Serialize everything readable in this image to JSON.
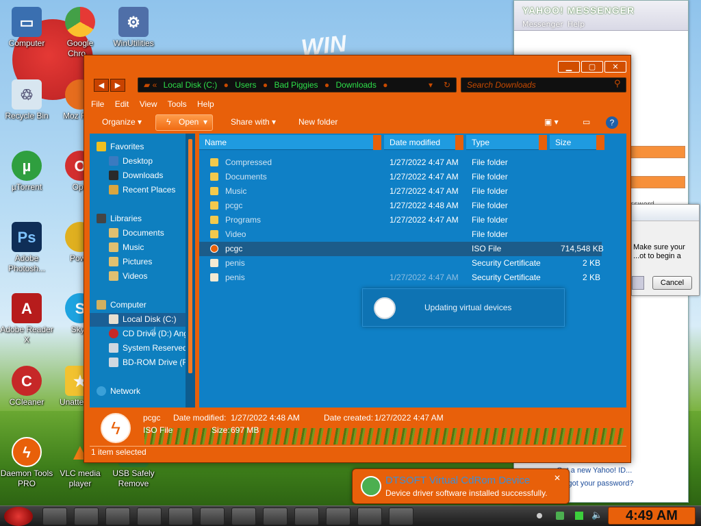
{
  "desktop": {
    "background_word": "WIN",
    "icons": [
      {
        "label": "Computer",
        "color": "#3a6fb0"
      },
      {
        "label": "Google Chro...",
        "color": "#e53935"
      },
      {
        "label": "WinUtilities",
        "color": "#4f6fa8"
      },
      {
        "label": "Recycle Bin",
        "color": "#d8e6f0"
      },
      {
        "label": "Moz Firef",
        "color": "#e66d1e"
      },
      {
        "label": "µTorrent",
        "color": "#2f9f3f"
      },
      {
        "label": "Ope",
        "color": "#d32f2f"
      },
      {
        "label": "Adobe Photosh...",
        "color": "#0f2e57"
      },
      {
        "label": "Powe",
        "color": "#e0b020"
      },
      {
        "label": "Adobe Reader X",
        "color": "#b71c1c"
      },
      {
        "label": "Skyp",
        "color": "#1ea3e0"
      },
      {
        "label": "CCleaner",
        "color": "#c62828"
      },
      {
        "label": "Unatte Soft",
        "color": "#f2c230"
      },
      {
        "label": "Daemon Tools PRO",
        "color": "#e8600a"
      },
      {
        "label": "VLC media player",
        "color": "#f07c14"
      },
      {
        "label": "USB Safely Remove",
        "color": "#2e7d32"
      }
    ]
  },
  "yahoo": {
    "title": "YAHOO! MESSENGER",
    "menu": [
      "Messenger",
      "Help"
    ],
    "link_new_id": "Get a new Yahoo! ID...",
    "link_forgot": "Forgot your password?",
    "partial_password": "ssword"
  },
  "dialog": {
    "text": "Make sure your ...ot to begin a",
    "cancel_label": "Cancel"
  },
  "explorer": {
    "window_controls": [
      "minimize",
      "maximize",
      "close"
    ],
    "address": [
      "Local Disk (C:)",
      "Users",
      "Bad Piggies",
      "Downloads"
    ],
    "search_placeholder": "Search Downloads",
    "menu": [
      "File",
      "Edit",
      "View",
      "Tools",
      "Help"
    ],
    "toolbar": {
      "organize": "Organize",
      "open": "Open",
      "share_with": "Share with",
      "new_folder": "New folder"
    },
    "sidebar": {
      "favorites": "Favorites",
      "fav_items": [
        "Desktop",
        "Downloads",
        "Recent Places"
      ],
      "libraries": "Libraries",
      "lib_items": [
        "Documents",
        "Music",
        "Pictures",
        "Videos"
      ],
      "computer": "Computer",
      "comp_items": [
        "Local Disk (C:)",
        "CD Drive (D:) Ang",
        "System Reserved",
        "BD-ROM Drive (F"
      ],
      "network": "Network"
    },
    "columns": {
      "name": "Name",
      "date": "Date modified",
      "type": "Type",
      "size": "Size"
    },
    "files": [
      {
        "name": "Compressed",
        "date": "1/27/2022 4:47 AM",
        "type": "File folder",
        "size": "",
        "icon": "folder"
      },
      {
        "name": "Documents",
        "date": "1/27/2022 4:47 AM",
        "type": "File folder",
        "size": "",
        "icon": "folder"
      },
      {
        "name": "Music",
        "date": "1/27/2022 4:47 AM",
        "type": "File folder",
        "size": "",
        "icon": "folder"
      },
      {
        "name": "pcgc",
        "date": "1/27/2022 4:48 AM",
        "type": "File folder",
        "size": "",
        "icon": "folder"
      },
      {
        "name": "Programs",
        "date": "1/27/2022 4:47 AM",
        "type": "File folder",
        "size": "",
        "icon": "folder"
      },
      {
        "name": "Video",
        "date": "",
        "type": "File folder",
        "size": "",
        "icon": "folder"
      },
      {
        "name": "pcgc",
        "date": "",
        "type": "ISO File",
        "size": "714,548 KB",
        "icon": "iso"
      },
      {
        "name": "penis",
        "date": "",
        "type": "Security Certificate",
        "size": "2 KB",
        "icon": "cert"
      },
      {
        "name": "penis",
        "date": "1/27/2022 4:47 AM",
        "type": "Security Certificate",
        "size": "2 KB",
        "icon": "cert"
      }
    ],
    "progress_popup": "Updating virtual devices",
    "details": {
      "name": "pcgc",
      "type": "ISO File",
      "date_modified_label": "Date modified:",
      "date_modified": "1/27/2022 4:48 AM",
      "date_created_label": "Date created:",
      "date_created": "1/27/2022 4:47 AM",
      "size_label": "Size:",
      "size": "697 MB"
    },
    "status": "1 item selected"
  },
  "notification": {
    "title": "DTSOFT Virtual CdRom Device",
    "message": "Device driver software installed successfully."
  },
  "taskbar": {
    "clock": "4:49 AM"
  },
  "colors": {
    "accent": "#e8600a",
    "pane": "#0f80c6"
  }
}
